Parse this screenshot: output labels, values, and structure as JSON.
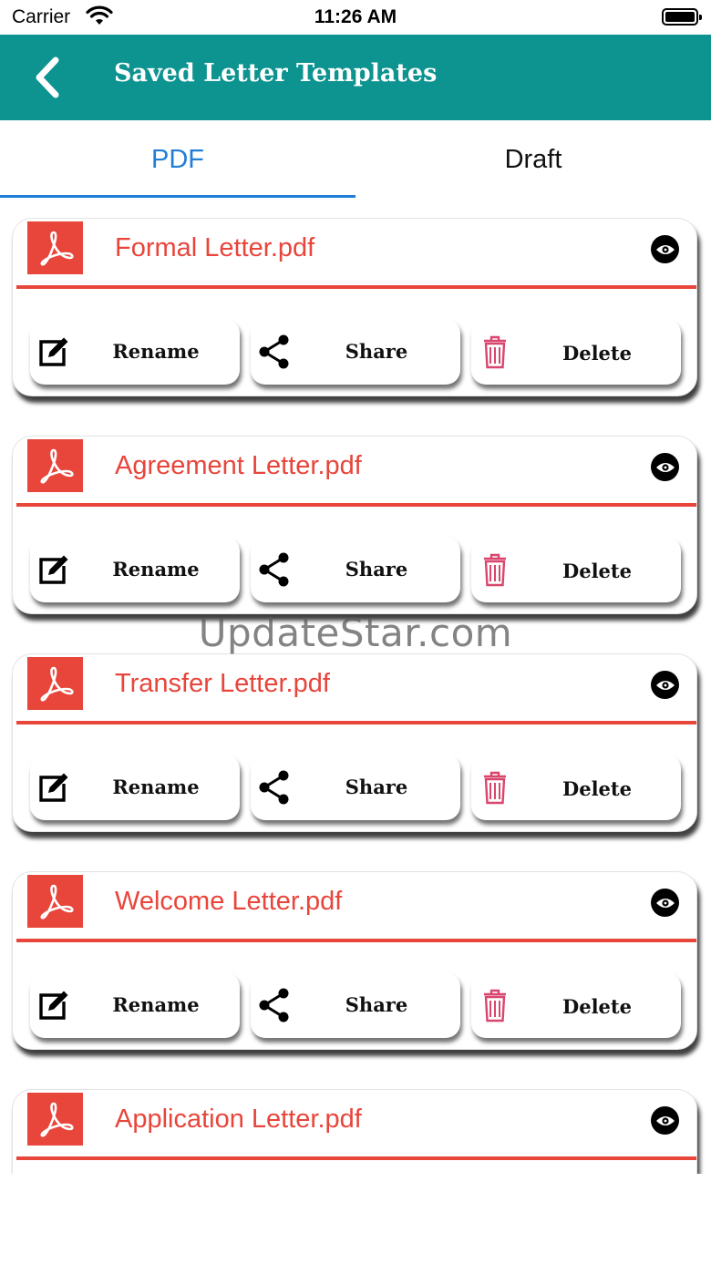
{
  "status_bar": {
    "carrier": "Carrier",
    "time": "11:26 AM"
  },
  "nav": {
    "title": "Saved Letter Templates",
    "back_icon": "chevron-left-icon"
  },
  "tabs": [
    {
      "label": "PDF",
      "active": true
    },
    {
      "label": "Draft",
      "active": false
    }
  ],
  "colors": {
    "header": "#0d9390",
    "accent_red": "#e8453b",
    "active_tab": "#1f7fd6",
    "delete_icon": "#d9466d"
  },
  "files": [
    {
      "name": "Formal Letter.pdf"
    },
    {
      "name": "Agreement Letter.pdf"
    },
    {
      "name": "Transfer Letter.pdf"
    },
    {
      "name": "Welcome Letter.pdf"
    },
    {
      "name": "Application Letter.pdf"
    }
  ],
  "actions": {
    "rename": "Rename",
    "share": "Share",
    "delete": "Delete"
  },
  "watermark": "UpdateStar.com"
}
